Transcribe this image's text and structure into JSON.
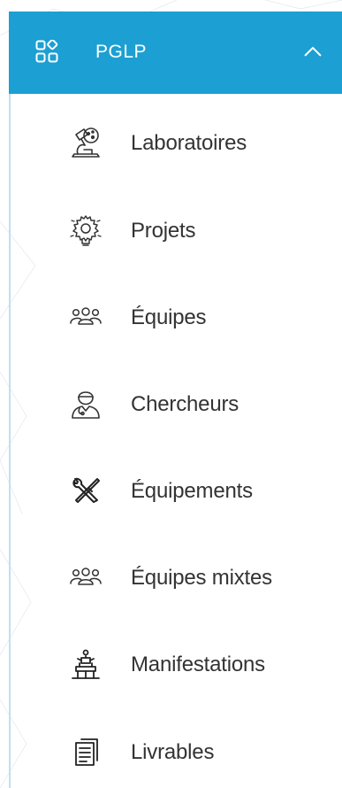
{
  "menu": {
    "title": "PGLP",
    "accent": "#1c9fd2",
    "items": [
      {
        "label": "Laboratoires",
        "icon": "microscope-icon"
      },
      {
        "label": "Projets",
        "icon": "lightbulb-gear-icon"
      },
      {
        "label": "Équipes",
        "icon": "team-icon"
      },
      {
        "label": "Chercheurs",
        "icon": "researcher-icon"
      },
      {
        "label": "Équipements",
        "icon": "tools-icon"
      },
      {
        "label": "Équipes mixtes",
        "icon": "team-icon"
      },
      {
        "label": "Manifestations",
        "icon": "podium-icon"
      },
      {
        "label": "Livrables",
        "icon": "documents-icon"
      }
    ]
  }
}
